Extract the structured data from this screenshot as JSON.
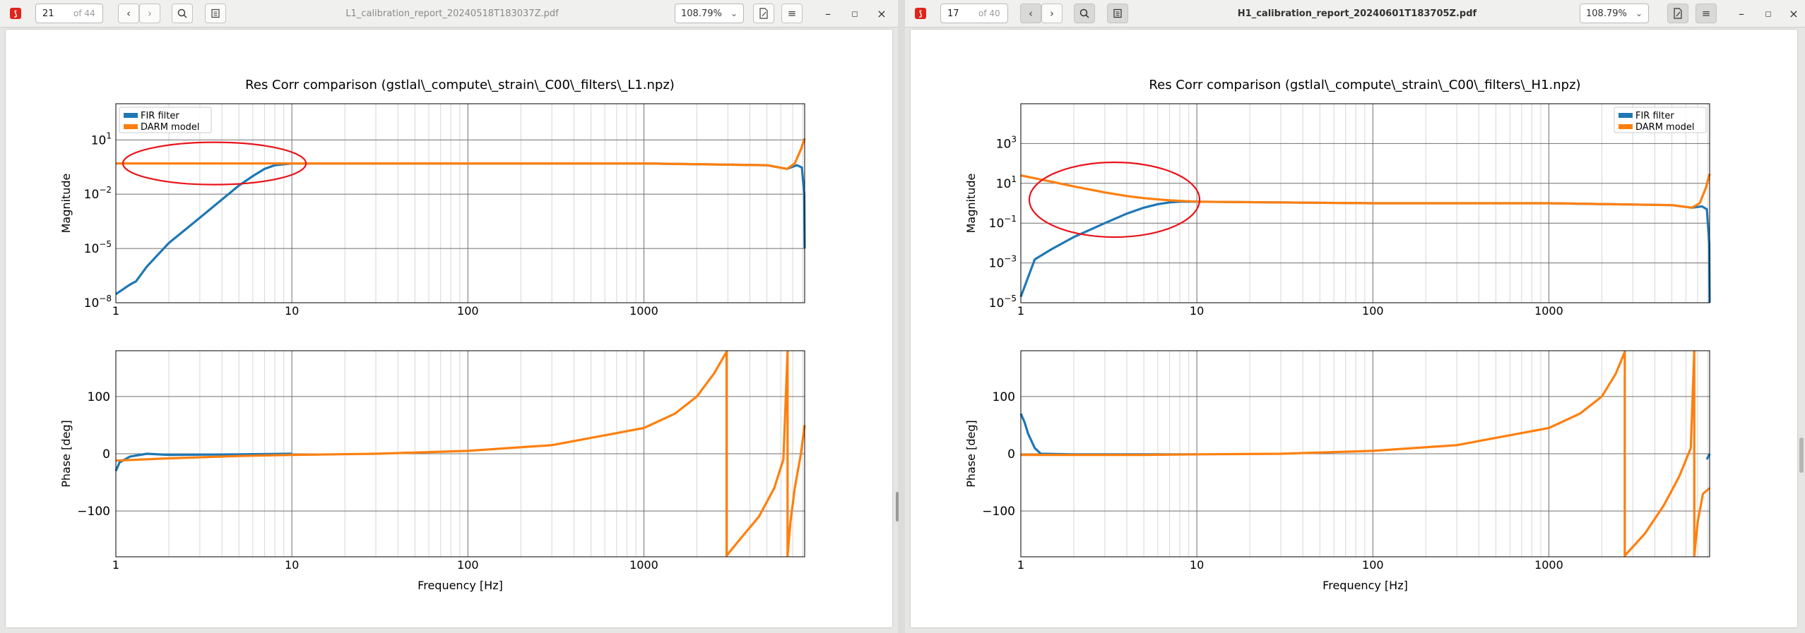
{
  "left": {
    "page_current": "21",
    "page_total": "of 44",
    "file_name": "L1_calibration_report_20240518T183037Z.pdf",
    "zoom": "108.79%",
    "figure": {
      "title": "Res Corr comparison (gstlal\\_compute\\_strain\\_C00\\_filters\\_L1.npz)",
      "mag_ylabel": "Magnitude",
      "phase_ylabel": "Phase [deg]",
      "xlabel": "Frequency [Hz]",
      "legend": [
        "FIR filter",
        "DARM model"
      ],
      "legend_position": "top-left",
      "annotation": "red ellipse around low-frequency divergence between FIR filter and DARM model (about 1.2–10 Hz)"
    }
  },
  "right": {
    "page_current": "17",
    "page_total": "of 40",
    "file_name": "H1_calibration_report_20240601T183705Z.pdf",
    "zoom": "108.79%",
    "figure": {
      "title": "Res Corr comparison (gstlal\\_compute\\_strain\\_C00\\_filters\\_H1.npz)",
      "mag_ylabel": "Magnitude",
      "phase_ylabel": "Phase [deg]",
      "xlabel": "Frequency [Hz]",
      "legend": [
        "FIR filter",
        "DARM model"
      ],
      "legend_position": "top-right",
      "annotation": "red ellipse around low-frequency divergence between FIR filter and DARM model (about 1–7 Hz)"
    }
  },
  "colors": {
    "fir": "#1f77b4",
    "darm": "#ff7f0e",
    "annotation": "#e8141b",
    "grid_major": "#6f6f6f",
    "grid_minor": "#d6d6d6"
  },
  "icons": [
    "pdf-app-icon",
    "chevron-left-icon",
    "chevron-right-icon",
    "search-icon",
    "sidebar-icon",
    "annotate-icon",
    "menu-icon",
    "minimize-icon",
    "maximize-icon",
    "close-icon"
  ],
  "chart_data": [
    {
      "id": "L1-magnitude",
      "type": "line",
      "title": "Res Corr comparison (gstlal\\_compute\\_strain\\_C00\\_filters\\_L1.npz)",
      "xlabel": "",
      "ylabel": "Magnitude",
      "xscale": "log",
      "yscale": "log",
      "xlim": [
        1,
        8192
      ],
      "ylim": [
        1e-08,
        1000
      ],
      "xticks": [
        1,
        10,
        100,
        1000
      ],
      "xtick_labels": [
        "1",
        "10",
        "100",
        "1000"
      ],
      "yticks": [
        1e-08,
        1e-05,
        0.01,
        10
      ],
      "ytick_labels": [
        [
          "10",
          "−8"
        ],
        [
          "10",
          "−5"
        ],
        [
          "10",
          "−2"
        ],
        [
          "10",
          "1"
        ]
      ],
      "grid": true,
      "legend_position": "top-left",
      "series": [
        {
          "name": "FIR filter",
          "x": [
            1,
            1.2,
            1.3,
            1.5,
            2,
            3,
            4,
            5,
            6,
            7,
            8,
            10,
            100,
            1000,
            5000,
            6500,
            7400,
            7900,
            8150,
            8192
          ],
          "y": [
            3e-08,
            1e-07,
            1.5e-07,
            1e-06,
            2e-05,
            0.0005,
            0.005,
            0.03,
            0.1,
            0.25,
            0.4,
            0.5,
            0.5,
            0.5,
            0.4,
            0.25,
            0.4,
            0.3,
            0.01,
            1e-05
          ]
        },
        {
          "name": "DARM model",
          "x": [
            1,
            10,
            100,
            1000,
            5000,
            6500,
            7200,
            7800,
            8192
          ],
          "y": [
            0.5,
            0.5,
            0.5,
            0.5,
            0.4,
            0.25,
            0.5,
            3,
            12
          ]
        }
      ]
    },
    {
      "id": "L1-phase",
      "type": "line",
      "xlabel": "Frequency [Hz]",
      "ylabel": "Phase [deg]",
      "xscale": "log",
      "xlim": [
        1,
        8192
      ],
      "ylim": [
        -180,
        180
      ],
      "xticks": [
        1,
        10,
        100,
        1000
      ],
      "xtick_labels": [
        "1",
        "10",
        "100",
        "1000"
      ],
      "yticks": [
        -100,
        0,
        100
      ],
      "ytick_labels": [
        "−100",
        "0",
        "100"
      ],
      "grid": true,
      "series": [
        {
          "name": "FIR filter",
          "x": [
            1,
            1.05,
            1.2,
            1.5,
            2,
            5,
            10
          ],
          "y": [
            -30,
            -15,
            -5,
            0,
            -2,
            -1,
            0
          ]
        },
        {
          "name": "DARM model",
          "x": [
            1,
            2,
            5,
            10,
            30,
            100,
            300,
            1000,
            1500,
            2000,
            2500,
            2950,
            2951,
            3500,
            4500,
            5500,
            6200,
            6550,
            6551,
            6800,
            7200,
            7800,
            8192
          ],
          "y": [
            -12,
            -8,
            -4,
            -2,
            0,
            5,
            15,
            45,
            70,
            100,
            140,
            178,
            -178,
            -150,
            -110,
            -60,
            -10,
            178,
            -178,
            -120,
            -60,
            0,
            50
          ]
        }
      ]
    },
    {
      "id": "H1-magnitude",
      "type": "line",
      "title": "Res Corr comparison (gstlal\\_compute\\_strain\\_C00\\_filters\\_H1.npz)",
      "xlabel": "",
      "ylabel": "Magnitude",
      "xscale": "log",
      "yscale": "log",
      "xlim": [
        1,
        8192
      ],
      "ylim": [
        1e-05,
        100000
      ],
      "xticks": [
        1,
        10,
        100,
        1000
      ],
      "xtick_labels": [
        "1",
        "10",
        "100",
        "1000"
      ],
      "yticks": [
        1e-05,
        0.001,
        0.1,
        10,
        1000
      ],
      "ytick_labels": [
        [
          "10",
          "−5"
        ],
        [
          "10",
          "−3"
        ],
        [
          "10",
          "−1"
        ],
        [
          "10",
          "1"
        ],
        [
          "10",
          "3"
        ]
      ],
      "grid": true,
      "legend_position": "top-right",
      "series": [
        {
          "name": "FIR filter",
          "x": [
            1,
            1.2,
            1.5,
            2,
            3,
            4,
            5,
            6,
            7,
            8,
            10,
            100,
            1000,
            5000,
            6500,
            7400,
            7900,
            8150,
            8192
          ],
          "y": [
            2e-05,
            0.0015,
            0.005,
            0.02,
            0.1,
            0.3,
            0.6,
            0.9,
            1.1,
            1.2,
            1.2,
            1.0,
            1.0,
            0.8,
            0.6,
            0.7,
            0.5,
            0.01,
            1e-05
          ]
        },
        {
          "name": "DARM model",
          "x": [
            1,
            1.5,
            2,
            3,
            4,
            5,
            7,
            10,
            100,
            1000,
            5000,
            6500,
            7200,
            7800,
            8192
          ],
          "y": [
            25,
            12,
            7,
            3.5,
            2.3,
            1.8,
            1.4,
            1.2,
            1.0,
            1.0,
            0.8,
            0.6,
            1.0,
            6,
            30
          ]
        }
      ]
    },
    {
      "id": "H1-phase",
      "type": "line",
      "xlabel": "Frequency [Hz]",
      "ylabel": "Phase [deg]",
      "xscale": "log",
      "xlim": [
        1,
        8192
      ],
      "ylim": [
        -180,
        180
      ],
      "xticks": [
        1,
        10,
        100,
        1000
      ],
      "xtick_labels": [
        "1",
        "10",
        "100",
        "1000"
      ],
      "yticks": [
        -100,
        0,
        100
      ],
      "ytick_labels": [
        "−100",
        "0",
        "100"
      ],
      "grid": true,
      "series": [
        {
          "name": "FIR filter",
          "x": [
            1,
            1.05,
            1.1,
            1.2,
            1.3,
            2,
            10
          ],
          "y": [
            70,
            55,
            35,
            10,
            0,
            -1,
            -1
          ]
        },
        {
          "name": "DARM model",
          "x": [
            1,
            2,
            5,
            10,
            30,
            100,
            300,
            1000,
            1500,
            2000,
            2400,
            2700,
            2701,
            3500,
            4500,
            5500,
            6400,
            6700,
            6701,
            7000,
            7500,
            8192
          ],
          "y": [
            -2,
            -2,
            -2,
            -1,
            0,
            5,
            15,
            45,
            70,
            100,
            140,
            178,
            -178,
            -140,
            -90,
            -40,
            10,
            178,
            -178,
            -120,
            -70,
            -60
          ]
        },
        {
          "name": "FIR filter (high-frequency tail)",
          "x": [
            7900,
            8192
          ],
          "y": [
            -10,
            0
          ]
        }
      ]
    }
  ]
}
